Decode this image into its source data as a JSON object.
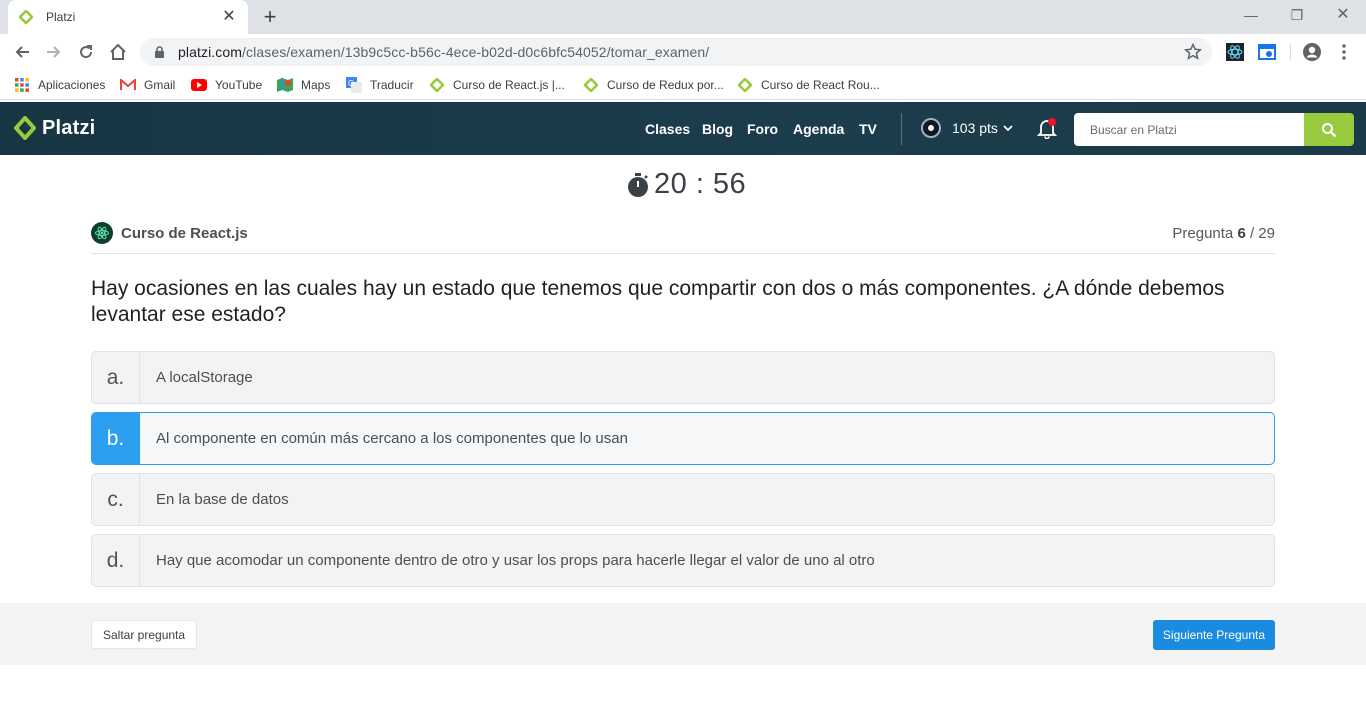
{
  "browser": {
    "tab_title": "Platzi",
    "url_host": "platzi.com",
    "url_path": "/clases/examen/13b9c5cc-b56c-4ece-b02d-d0c6bfc54052/tomar_examen/",
    "bookmarks": [
      {
        "label": "Aplicaciones",
        "icon": "apps-grid-icon"
      },
      {
        "label": "Gmail",
        "icon": "gmail-icon"
      },
      {
        "label": "YouTube",
        "icon": "youtube-icon"
      },
      {
        "label": "Maps",
        "icon": "maps-icon"
      },
      {
        "label": "Traducir",
        "icon": "translate-icon"
      },
      {
        "label": "Curso de React.js |...",
        "icon": "platzi-icon"
      },
      {
        "label": "Curso de Redux por...",
        "icon": "platzi-icon"
      },
      {
        "label": "Curso de React Rou...",
        "icon": "platzi-icon"
      }
    ]
  },
  "header": {
    "brand": "Platzi",
    "nav": [
      "Clases",
      "Blog",
      "Foro",
      "Agenda",
      "TV"
    ],
    "points": "103 pts",
    "search_placeholder": "Buscar en Platzi"
  },
  "exam": {
    "timer": "20 : 56",
    "course": "Curso de React.js",
    "counter_prefix": "Pregunta",
    "current": "6",
    "total": "/ 29",
    "question": "Hay ocasiones en las cuales hay un estado que tenemos que compartir con dos o más componentes. ¿A dónde debemos levantar ese estado?",
    "options": [
      {
        "letter": "a.",
        "text": "A localStorage",
        "selected": false
      },
      {
        "letter": "b.",
        "text": "Al componente en común más cercano a los componentes que lo usan",
        "selected": true
      },
      {
        "letter": "c.",
        "text": "En la base de datos",
        "selected": false
      },
      {
        "letter": "d.",
        "text": "Hay que acomodar un componente dentro de otro y usar los props para hacerle llegar el valor de uno al otro",
        "selected": false
      }
    ],
    "skip_label": "Saltar pregunta",
    "next_label": "Siguiente Pregunta"
  },
  "colors": {
    "platzi_green": "#98ca3f",
    "header_bg": "#1c3d4c",
    "selected_blue": "#2d9ff0",
    "button_blue": "#1b8be0"
  }
}
